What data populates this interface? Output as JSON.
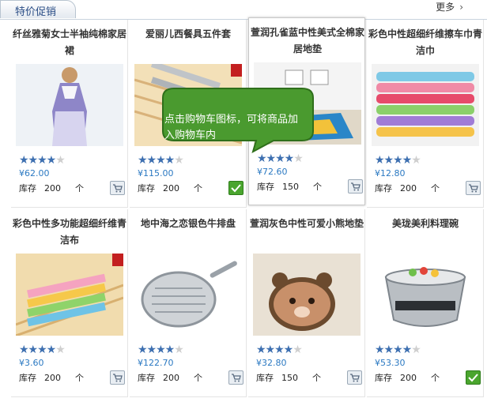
{
  "header": {
    "tab_label": "特价促销",
    "more_label": "更多"
  },
  "products": [
    {
      "title": "纤丝雅菊女士半袖纯棉家居裙",
      "price": "¥62.00",
      "stars": 4,
      "stock_label": "库存",
      "stock": "200",
      "unit": "个",
      "status": "cart"
    },
    {
      "title": "爱丽儿西餐具五件套",
      "price": "¥115.00",
      "stars": 4,
      "stock_label": "库存",
      "stock": "200",
      "unit": "个",
      "status": "added"
    },
    {
      "title": "萱润孔雀蓝中性美式全棉家居地垫",
      "price": "¥72.60",
      "stars": 4,
      "stock_label": "库存",
      "stock": "150",
      "unit": "个",
      "status": "cart"
    },
    {
      "title": "彩色中性超细纤维擦车巾青洁巾",
      "price": "¥12.80",
      "stars": 4,
      "stock_label": "库存",
      "stock": "200",
      "unit": "个",
      "status": "cart"
    },
    {
      "title": "彩色中性多功能超细纤维青洁布",
      "price": "¥3.60",
      "stars": 4,
      "stock_label": "库存",
      "stock": "200",
      "unit": "个",
      "status": "cart"
    },
    {
      "title": "地中海之恋银色牛排盘",
      "price": "¥122.70",
      "stars": 4,
      "stock_label": "库存",
      "stock": "200",
      "unit": "个",
      "status": "cart"
    },
    {
      "title": "萱润灰色中性可爱小熊地垫",
      "price": "¥32.80",
      "stars": 4,
      "stock_label": "库存",
      "stock": "150",
      "unit": "个",
      "status": "cart"
    },
    {
      "title": "美珑美利料理碗",
      "price": "¥53.30",
      "stars": 4,
      "stock_label": "库存",
      "stock": "200",
      "unit": "个",
      "status": "added"
    }
  ],
  "tooltip": {
    "text": "点击购物车图标，可将商品加入购物车内"
  },
  "colors": {
    "price": "#2b79c2",
    "star": "#3d6fb0",
    "bubble": "#4a9a2f",
    "check": "#4aa52e"
  }
}
